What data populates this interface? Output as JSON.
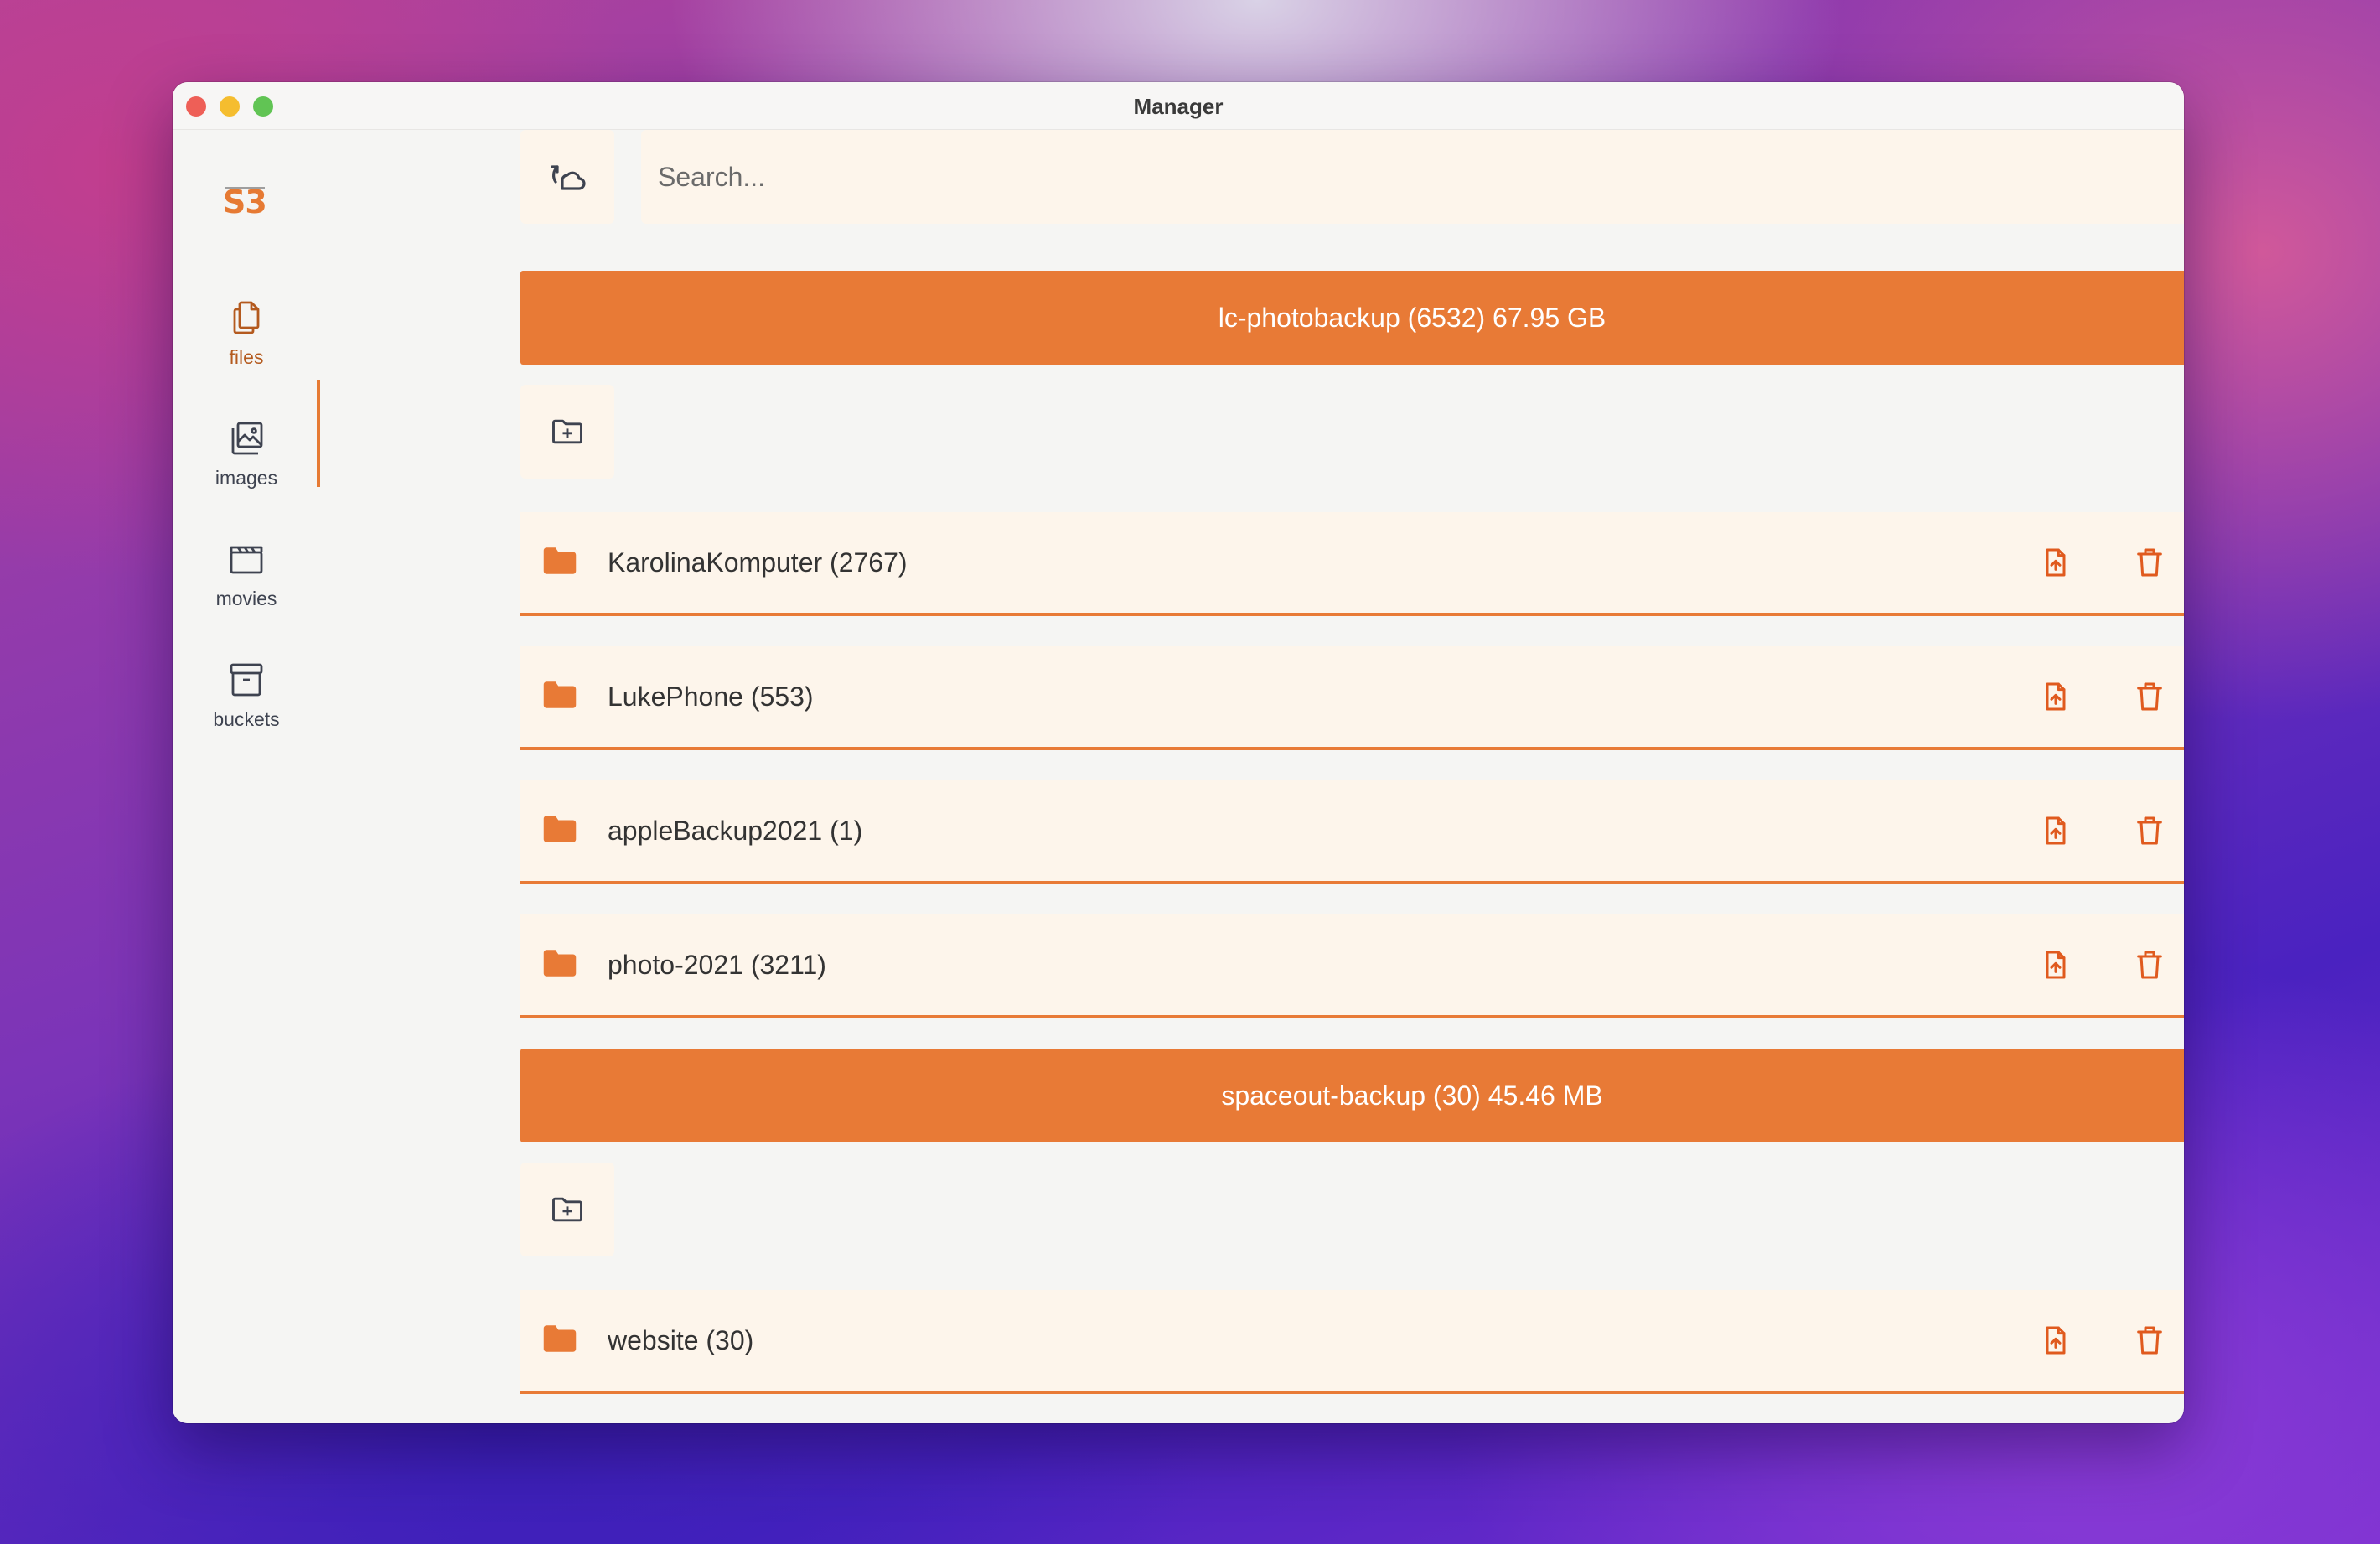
{
  "window": {
    "title": "Manager"
  },
  "sidebar": {
    "logo": "S3",
    "items": [
      {
        "label": "files",
        "icon": "files-icon",
        "active": true
      },
      {
        "label": "images",
        "icon": "images-icon",
        "active": false
      },
      {
        "label": "movies",
        "icon": "clapperboard-icon",
        "active": false
      },
      {
        "label": "buckets",
        "icon": "archive-box-icon",
        "active": false
      }
    ]
  },
  "toolbar": {
    "refresh_icon": "refresh-cloud-icon",
    "search_placeholder": "Search..."
  },
  "buckets": [
    {
      "header": "lc-photobackup (6532) 67.95 GB",
      "folders": [
        {
          "name": "KarolinaKomputer (2767)"
        },
        {
          "name": "LukePhone (553)"
        },
        {
          "name": "appleBackup2021 (1)"
        },
        {
          "name": "photo-2021 (3211)"
        }
      ]
    },
    {
      "header": "spaceout-backup (30) 45.46 MB",
      "folders": [
        {
          "name": "website (30)"
        }
      ]
    }
  ],
  "colors": {
    "accent": "#e87a36",
    "tile_bg": "#fdf5eb",
    "window_bg": "#f5f5f3",
    "icon_orange": "#e05a1e",
    "text_dark": "#333333"
  }
}
